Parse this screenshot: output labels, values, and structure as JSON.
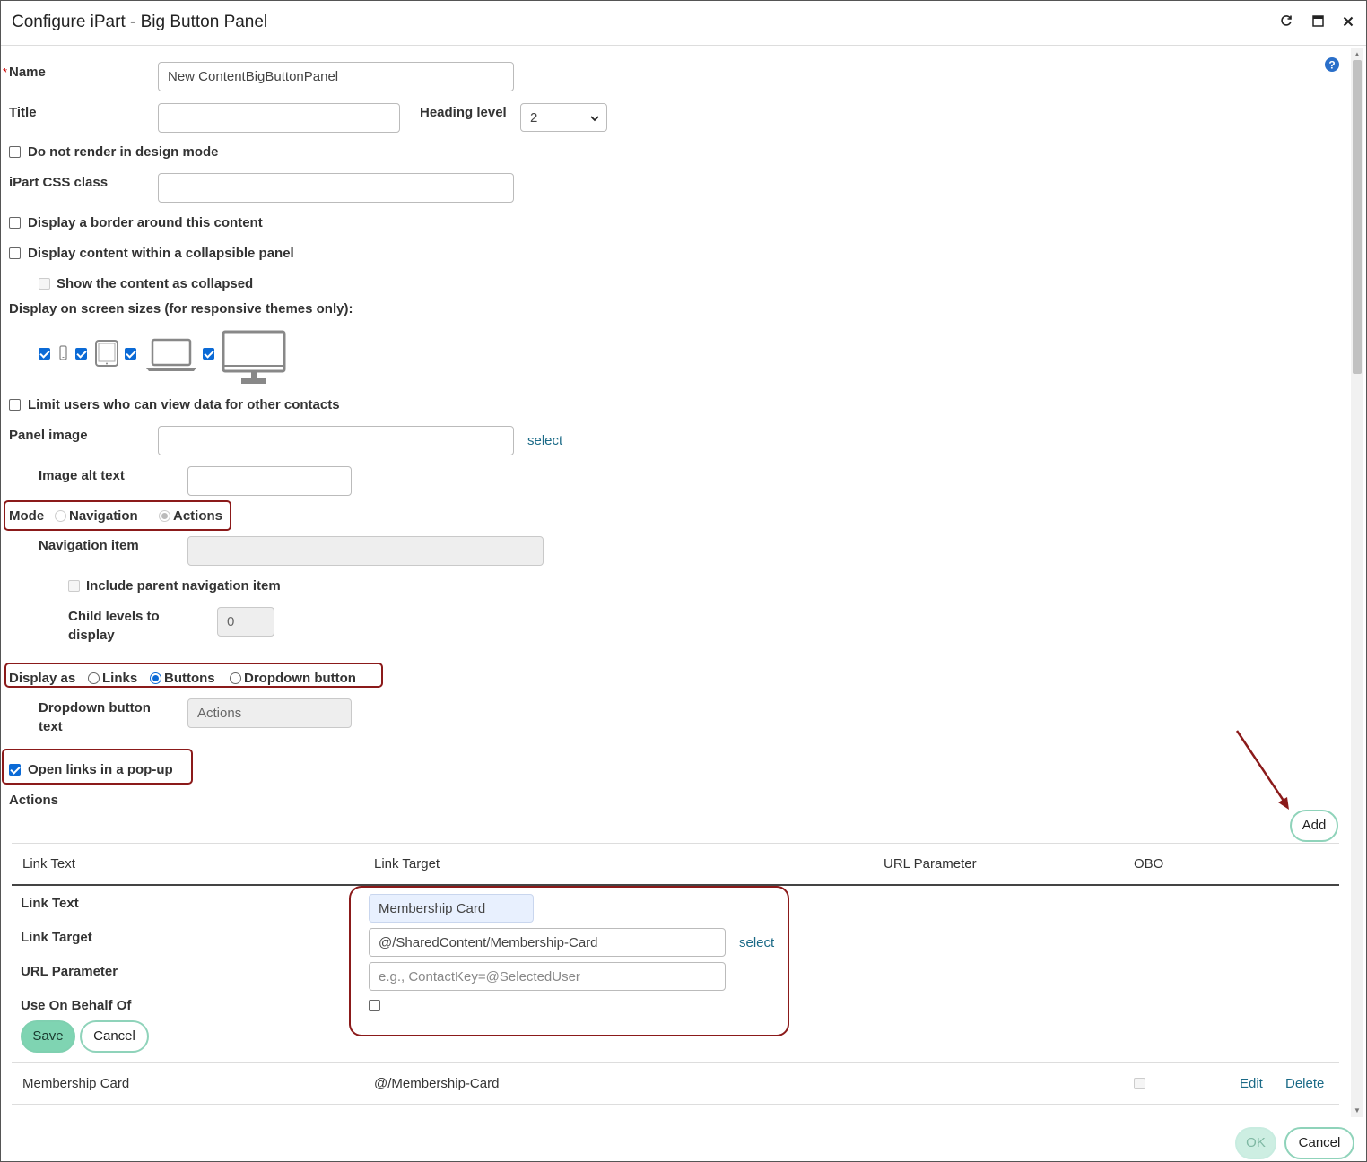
{
  "dialog": {
    "title": "Configure iPart - Big Button Panel",
    "controls": [
      "refresh-icon",
      "maximize-icon",
      "close-icon"
    ]
  },
  "help_icon": "question-icon",
  "form": {
    "required_marker": "*",
    "name_label": "Name",
    "name_value": "New ContentBigButtonPanel",
    "title_label": "Title",
    "title_value": "",
    "heading_level_label": "Heading level",
    "heading_level_value": "2",
    "no_render_label": "Do not render in design mode",
    "css_class_label": "iPart CSS class",
    "border_label": "Display a border around this content",
    "collapsible_label": "Display content within a collapsible panel",
    "collapsed_label": "Show the content as collapsed",
    "screen_sizes_label": "Display on screen sizes (for responsive themes only):",
    "screen_sizes": [
      {
        "device": "phone-icon",
        "checked": true
      },
      {
        "device": "tablet-icon",
        "checked": true
      },
      {
        "device": "laptop-icon",
        "checked": true
      },
      {
        "device": "desktop-icon",
        "checked": true
      }
    ],
    "limit_users_label": "Limit users who can view data for other contacts",
    "panel_image_label": "Panel image",
    "panel_image_select": "select",
    "image_alt_label": "Image alt text",
    "mode_label": "Mode",
    "mode_navigation": "Navigation",
    "mode_actions": "Actions",
    "navigation_item_label": "Navigation item",
    "include_parent_label": "Include parent navigation item",
    "child_levels_label_1": "Child levels to",
    "child_levels_label_2": "display",
    "child_levels_value": "0",
    "display_as_label": "Display as",
    "display_links": "Links",
    "display_buttons": "Buttons",
    "display_dropdown": "Dropdown button",
    "dropdown_text_label_1": "Dropdown button",
    "dropdown_text_label_2": "text",
    "dropdown_text_value": "Actions",
    "popup_label": "Open links in a pop-up",
    "actions_heading": "Actions"
  },
  "actions_table": {
    "add_label": "Add",
    "columns": [
      "Link Text",
      "Link Target",
      "URL Parameter",
      "OBO"
    ],
    "editor": {
      "link_text_label": "Link Text",
      "link_text_value": "Membership Card",
      "link_target_label": "Link Target",
      "link_target_value": "@/SharedContent/Membership-Card",
      "link_target_select": "select",
      "url_param_label": "URL Parameter",
      "url_param_placeholder": "e.g., ContactKey=@SelectedUser",
      "obo_label": "Use On Behalf Of",
      "save_label": "Save",
      "cancel_label": "Cancel"
    },
    "rows": [
      {
        "link_text": "Membership Card",
        "link_target": "@/Membership-Card",
        "obo": false,
        "edit": "Edit",
        "delete": "Delete"
      }
    ]
  },
  "footer": {
    "ok_label": "OK",
    "cancel_label": "Cancel"
  },
  "colors": {
    "highlight": "#8b1a1a",
    "accent_green": "#7fd4b2",
    "link_blue": "#1b6a87"
  }
}
